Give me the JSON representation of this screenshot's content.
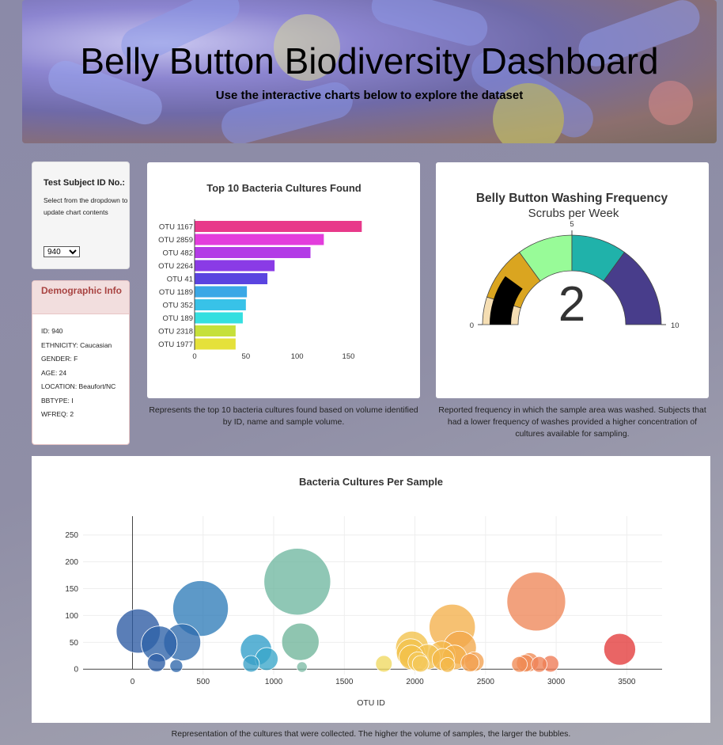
{
  "header": {
    "title": "Belly Button Biodiversity Dashboard",
    "subtitle": "Use the interactive charts below to explore the dataset"
  },
  "selector": {
    "label": "Test Subject ID No.:",
    "hint": "Select from the dropdown to update chart contents",
    "selected": "940"
  },
  "demographics": {
    "heading": "Demographic Info",
    "rows": [
      "ID: 940",
      "ETHNICITY: Caucasian",
      "GENDER: F",
      "AGE: 24",
      "LOCATION: Beaufort/NC",
      "BBTYPE: I",
      "WFREQ: 2"
    ]
  },
  "bar_caption": "Represents the top 10 bacteria cultures found based on volume identified by ID, name and sample volume.",
  "gauge_caption": "Reported frequency in which the sample area was washed. Subjects that had a lower frequency of washes provided a higher concentration of cultures available for sampling.",
  "bubble_caption": "Representation of the cultures that were collected. The higher the volume of samples, the larger the bubbles.",
  "colors": {
    "bar_series": [
      "#e8398a",
      "#e33ddc",
      "#b33be6",
      "#8a3be6",
      "#5a44e0",
      "#3aa8e6",
      "#38c2e8",
      "#35dfe0",
      "#c6e03a",
      "#e5e13a"
    ],
    "gauge_steps": [
      "#f5deb3",
      "#daa520",
      "#98fb98",
      "#20b2aa",
      "#483d8b"
    ]
  },
  "chart_data": [
    {
      "type": "bar",
      "orientation": "horizontal",
      "title": "Top 10 Bacteria Cultures Found",
      "categories": [
        "OTU 1167",
        "OTU 2859",
        "OTU 482",
        "OTU 2264",
        "OTU 41",
        "OTU 1189",
        "OTU 352",
        "OTU 189",
        "OTU 2318",
        "OTU 1977"
      ],
      "values": [
        163,
        126,
        113,
        78,
        71,
        51,
        50,
        47,
        40,
        40
      ],
      "xlim": [
        0,
        172
      ],
      "xticks": [
        0,
        50,
        100,
        150
      ],
      "grid": false
    },
    {
      "type": "gauge",
      "title": "Belly Button Washing Frequency",
      "subtitle": "Scrubs per Week",
      "value": 2,
      "range": [
        0,
        10
      ],
      "tick_labels": [
        "0",
        "5",
        "10"
      ],
      "steps": [
        [
          0,
          1
        ],
        [
          1,
          3
        ],
        [
          3,
          5
        ],
        [
          5,
          7
        ],
        [
          7,
          10
        ]
      ]
    },
    {
      "type": "scatter",
      "title": "Bacteria Cultures Per Sample",
      "xlabel": "OTU ID",
      "ylabel": "",
      "xlim": [
        -350,
        3750
      ],
      "ylim": [
        -10,
        285
      ],
      "xticks": [
        0,
        500,
        1000,
        1500,
        2000,
        2500,
        3000,
        3500
      ],
      "yticks": [
        0,
        50,
        100,
        150,
        200,
        250
      ],
      "grid": true,
      "points": [
        {
          "x": 41,
          "y": 71,
          "c": "#2b5aa3"
        },
        {
          "x": 189,
          "y": 47,
          "c": "#2d62a8"
        },
        {
          "x": 352,
          "y": 50,
          "c": "#2e6aad"
        },
        {
          "x": 482,
          "y": 113,
          "c": "#2f7cb8"
        },
        {
          "x": 170,
          "y": 12,
          "c": "#2d5ea5"
        },
        {
          "x": 310,
          "y": 6,
          "c": "#2e66aa"
        },
        {
          "x": 875,
          "y": 36,
          "c": "#2f9ec9"
        },
        {
          "x": 950,
          "y": 19,
          "c": "#3aa6c9"
        },
        {
          "x": 840,
          "y": 10,
          "c": "#3aa0c7"
        },
        {
          "x": 1167,
          "y": 163,
          "c": "#6fb7a0"
        },
        {
          "x": 1189,
          "y": 51,
          "c": "#6fb59a"
        },
        {
          "x": 1200,
          "y": 4,
          "c": "#7dbba5"
        },
        {
          "x": 1780,
          "y": 10,
          "c": "#f0d860"
        },
        {
          "x": 1980,
          "y": 40,
          "c": "#f2c24a"
        },
        {
          "x": 1970,
          "y": 30,
          "c": "#f2c24a"
        },
        {
          "x": 1975,
          "y": 22,
          "c": "#f2c24a"
        },
        {
          "x": 2020,
          "y": 14,
          "c": "#f3c85a"
        },
        {
          "x": 2040,
          "y": 10,
          "c": "#f3c85a"
        },
        {
          "x": 2090,
          "y": 23,
          "c": "#f2c250"
        },
        {
          "x": 2190,
          "y": 27,
          "c": "#f3b84a"
        },
        {
          "x": 2200,
          "y": 18,
          "c": "#f3b84a"
        },
        {
          "x": 2230,
          "y": 8,
          "c": "#f3b84a"
        },
        {
          "x": 2264,
          "y": 78,
          "c": "#f3b04a"
        },
        {
          "x": 2280,
          "y": 22,
          "c": "#f3b04a"
        },
        {
          "x": 2318,
          "y": 40,
          "c": "#f2a84a"
        },
        {
          "x": 2390,
          "y": 12,
          "c": "#f2a050"
        },
        {
          "x": 2420,
          "y": 14,
          "c": "#f2a050"
        },
        {
          "x": 2740,
          "y": 9,
          "c": "#ef8a55"
        },
        {
          "x": 2780,
          "y": 11,
          "c": "#ef8a55"
        },
        {
          "x": 2810,
          "y": 13,
          "c": "#ef8a55"
        },
        {
          "x": 2859,
          "y": 126,
          "c": "#ee8658"
        },
        {
          "x": 2880,
          "y": 9,
          "c": "#ee8055"
        },
        {
          "x": 2960,
          "y": 10,
          "c": "#ee7a55"
        },
        {
          "x": 3450,
          "y": 37,
          "c": "#e33a3a"
        }
      ]
    }
  ]
}
